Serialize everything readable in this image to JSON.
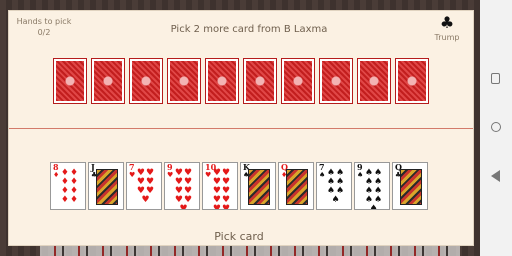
{
  "header": {
    "hands_label": "Hands to pick",
    "hands_value": "0/2",
    "message": "Pick 2 more card from B Laxma",
    "trump_label": "Trump",
    "trump_suit": "♣"
  },
  "opponent_cards_count": 10,
  "player_hand": [
    {
      "rank": "8",
      "suit": "♦",
      "color": "red",
      "pips": "♦♦♦♦♦♦♦♦"
    },
    {
      "rank": "J",
      "suit": "♣",
      "color": "black",
      "face": true
    },
    {
      "rank": "7",
      "suit": "♥",
      "color": "red",
      "pips": "♥♥♥♥♥♥♥"
    },
    {
      "rank": "9",
      "suit": "♥",
      "color": "red",
      "pips": "♥♥♥♥♥♥♥♥♥"
    },
    {
      "rank": "10",
      "suit": "♥",
      "color": "red",
      "pips": "♥♥♥♥♥♥♥♥♥♥"
    },
    {
      "rank": "K",
      "suit": "♠",
      "color": "black",
      "face": true
    },
    {
      "rank": "Q",
      "suit": "♦",
      "color": "red",
      "face": true
    },
    {
      "rank": "7",
      "suit": "♠",
      "color": "black",
      "pips": "♠♠♠♠♠♠♠"
    },
    {
      "rank": "9",
      "suit": "♠",
      "color": "black",
      "pips": "♠♠♠♠♠♠♠♠♠"
    },
    {
      "rank": "Q",
      "suit": "♣",
      "color": "black",
      "face": true
    }
  ],
  "footer": {
    "action_label": "Pick card"
  }
}
